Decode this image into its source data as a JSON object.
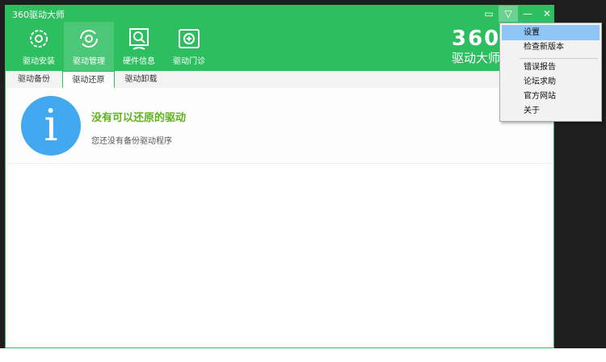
{
  "window": {
    "title": "360驱动大师"
  },
  "toolbar": [
    {
      "label": "驱动安装",
      "icon": "gear-icon"
    },
    {
      "label": "驱动管理",
      "icon": "refresh-icon"
    },
    {
      "label": "硬件信息",
      "icon": "monitor-search-icon"
    },
    {
      "label": "驱动门诊",
      "icon": "clinic-icon"
    }
  ],
  "logo": {
    "number": "360",
    "text": "驱动大师"
  },
  "tabs": [
    "驱动备份",
    "驱动还原",
    "驱动卸载"
  ],
  "info": {
    "title": "没有可以还原的驱动",
    "subtitle": "您还没有备份驱动程序",
    "icon": "i"
  },
  "menu": {
    "items": [
      "设置",
      "检查新版本",
      "错误报告",
      "论坛求助",
      "官方网站",
      "关于"
    ]
  },
  "colors": {
    "brand": "#2dbe60",
    "info_title": "#5eb31a",
    "info_icon": "#42a8ef",
    "menu_highlight": "#8fc6f6"
  }
}
